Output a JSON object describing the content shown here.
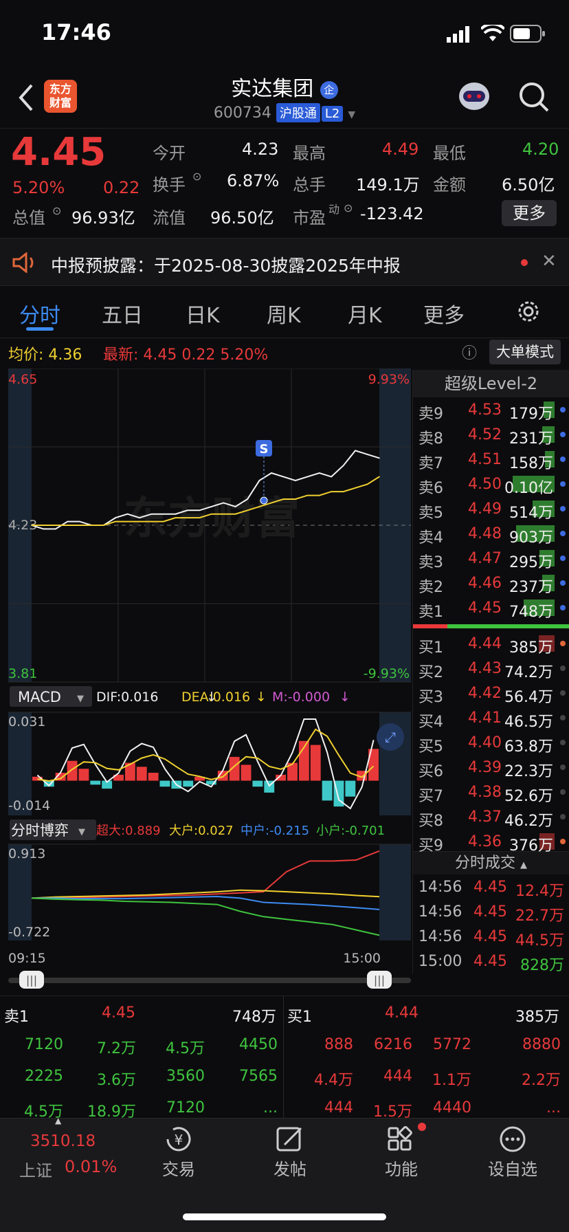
{
  "status": {
    "time": "17:46"
  },
  "header": {
    "name": "实达集团",
    "badge": "企",
    "logo_text": "东方\n财富",
    "code": "600734",
    "chip1": "沪股通",
    "chip2": "L2"
  },
  "quote": {
    "price": "4.45",
    "pct": "5.20%",
    "change": "0.22",
    "open_label": "今开",
    "open": "4.23",
    "high_label": "最高",
    "high": "4.49",
    "low_label": "最低",
    "low": "4.20",
    "turnover_label": "换手",
    "turnover": "6.87%",
    "volume_label": "总手",
    "volume": "149.1万",
    "amount_label": "金额",
    "amount": "6.50亿",
    "mktcap_label": "总值",
    "mktcap": "96.93亿",
    "float_label": "流值",
    "float": "96.50亿",
    "pe_label": "市盈",
    "pe_sup": "动",
    "pe": "-123.42",
    "more": "更多"
  },
  "notice": {
    "text": "中报预披露：于2025-08-30披露2025年中报"
  },
  "tabs": [
    "分时",
    "五日",
    "日K",
    "周K",
    "月K",
    "更多"
  ],
  "avg": {
    "avg_label": "均价:",
    "avg": "4.36",
    "latest_label": "最新:",
    "latest": "4.45",
    "chg": "0.22",
    "pct": "5.20%",
    "mode": "大单模式"
  },
  "chart_data": [
    {
      "type": "line",
      "title": "",
      "y_top": "4.65",
      "y_bottom": "3.81",
      "y_mid": "4.23",
      "pct_top": "9.93%",
      "pct_bottom": "-9.93%",
      "ylim": [
        3.81,
        4.65
      ],
      "x_labels": [
        "09:15",
        "15:00"
      ],
      "series": [
        {
          "name": "",
          "values": [
            4.23,
            4.22,
            4.22,
            4.24,
            4.24,
            4.23,
            4.23,
            4.25,
            4.26,
            4.25,
            4.26,
            4.26,
            4.26,
            4.27,
            4.27,
            4.28,
            4.29,
            4.28,
            4.3,
            4.35,
            4.37,
            4.36,
            4.35,
            4.36,
            4.37,
            4.36,
            4.39,
            4.43,
            4.42,
            4.41
          ]
        },
        {
          "name": "",
          "values": [
            4.23,
            4.23,
            4.23,
            4.23,
            4.23,
            4.23,
            4.23,
            4.24,
            4.24,
            4.24,
            4.24,
            4.24,
            4.25,
            4.25,
            4.25,
            4.26,
            4.26,
            4.26,
            4.27,
            4.28,
            4.29,
            4.3,
            4.3,
            4.31,
            4.31,
            4.32,
            4.32,
            4.33,
            4.34,
            4.36
          ]
        }
      ]
    },
    {
      "type": "bar",
      "title": "MACD",
      "dif": "DIF:0.016",
      "dea": "DEA:0.016",
      "m": "M:-0.000",
      "ymax_label": "0.031",
      "ymin_label": "-0.014",
      "ylim": [
        -0.014,
        0.031
      ],
      "values": [
        0.002,
        -0.003,
        0.004,
        0.01,
        0.006,
        -0.002,
        -0.004,
        0.003,
        0.009,
        0.007,
        0.004,
        -0.003,
        -0.004,
        -0.003,
        0.002,
        -0.002,
        0.005,
        0.012,
        0.008,
        -0.003,
        -0.006,
        0.003,
        0.009,
        0.02,
        0.018,
        -0.01,
        -0.013,
        -0.008,
        0.005,
        0.016
      ]
    },
    {
      "type": "line",
      "title": "分时博弈",
      "ymax_label": "0.913",
      "ymin_label": "-0.722",
      "ylim": [
        -0.722,
        0.913
      ],
      "series": [
        {
          "name": "超大:0.889",
          "values": [
            0,
            0,
            0.01,
            0.02,
            0.03,
            0.04,
            0.05,
            0.06,
            0.08,
            0.1,
            0.12,
            0.5,
            0.7,
            0.7,
            0.72,
            0.889
          ]
        },
        {
          "name": "大户:0.027",
          "values": [
            0,
            0.02,
            0.03,
            0.04,
            0.05,
            0.06,
            0.08,
            0.1,
            0.12,
            0.15,
            0.14,
            0.12,
            0.1,
            0.08,
            0.05,
            0.027
          ]
        },
        {
          "name": "中户:-0.215",
          "values": [
            0,
            0,
            -0.01,
            -0.01,
            -0.01,
            0,
            0.01,
            0.02,
            0.03,
            0.0,
            -0.08,
            -0.1,
            -0.12,
            -0.15,
            -0.18,
            -0.215
          ]
        },
        {
          "name": "小户:-0.701",
          "values": [
            0,
            -0.02,
            -0.03,
            -0.04,
            -0.06,
            -0.07,
            -0.08,
            -0.1,
            -0.12,
            -0.25,
            -0.35,
            -0.4,
            -0.45,
            -0.5,
            -0.6,
            -0.701
          ]
        }
      ]
    }
  ],
  "level2": {
    "title": "超级Level-2",
    "sells": [
      {
        "l": "卖9",
        "p": "4.53",
        "v": "179万",
        "fill": 0.18
      },
      {
        "l": "卖8",
        "p": "4.52",
        "v": "231万",
        "fill": 0.2
      },
      {
        "l": "卖7",
        "p": "4.51",
        "v": "158万",
        "fill": 0.16
      },
      {
        "l": "卖6",
        "p": "4.50",
        "v": "0.10亿",
        "fill": 0.68
      },
      {
        "l": "卖5",
        "p": "4.49",
        "v": "514万",
        "fill": 0.36
      },
      {
        "l": "卖4",
        "p": "4.48",
        "v": "903万",
        "fill": 0.62
      },
      {
        "l": "卖3",
        "p": "4.47",
        "v": "295万",
        "fill": 0.24
      },
      {
        "l": "卖2",
        "p": "4.46",
        "v": "237万",
        "fill": 0.2
      },
      {
        "l": "卖1",
        "p": "4.45",
        "v": "748万",
        "fill": 0.5
      }
    ],
    "buys": [
      {
        "l": "买1",
        "p": "4.44",
        "v": "385万",
        "fill": 0.26
      },
      {
        "l": "买2",
        "p": "4.43",
        "v": "74.2万",
        "fill": 0
      },
      {
        "l": "买3",
        "p": "4.42",
        "v": "56.4万",
        "fill": 0
      },
      {
        "l": "买4",
        "p": "4.41",
        "v": "46.5万",
        "fill": 0
      },
      {
        "l": "买5",
        "p": "4.40",
        "v": "63.8万",
        "fill": 0
      },
      {
        "l": "买6",
        "p": "4.39",
        "v": "22.3万",
        "fill": 0
      },
      {
        "l": "买7",
        "p": "4.38",
        "v": "52.6万",
        "fill": 0
      },
      {
        "l": "买8",
        "p": "4.37",
        "v": "46.2万",
        "fill": 0
      },
      {
        "l": "买9",
        "p": "4.36",
        "v": "376万",
        "fill": 0.25
      }
    ],
    "ticks_title": "分时成交",
    "ticks": [
      {
        "t": "14:56",
        "p": "4.45",
        "v": "12.4万"
      },
      {
        "t": "14:56",
        "p": "4.45",
        "v": "22.7万"
      },
      {
        "t": "14:56",
        "p": "4.45",
        "v": "44.5万"
      },
      {
        "t": "15:00",
        "p": "4.45",
        "v": "828万"
      }
    ]
  },
  "queue": {
    "sell_label": "卖1",
    "sell_price": "4.45",
    "sell_vol": "748万",
    "buy_label": "买1",
    "buy_price": "4.44",
    "buy_vol": "385万",
    "sell_rows": [
      [
        "7120",
        "7.2万",
        "4.5万",
        "4450"
      ],
      [
        "2225",
        "3.6万",
        "3560",
        "7565"
      ],
      [
        "4.5万",
        "18.9万",
        "7120",
        "..."
      ]
    ],
    "buy_rows": [
      [
        "888",
        "6216",
        "5772",
        "8880"
      ],
      [
        "4.4万",
        "444",
        "1.1万",
        "2.2万"
      ],
      [
        "444",
        "1.5万",
        "4440",
        "..."
      ]
    ]
  },
  "nav": {
    "index_value": "3510.18",
    "index_name": "上证",
    "index_pct": "0.01%",
    "items": [
      "交易",
      "发帖",
      "功能",
      "设自选"
    ]
  }
}
